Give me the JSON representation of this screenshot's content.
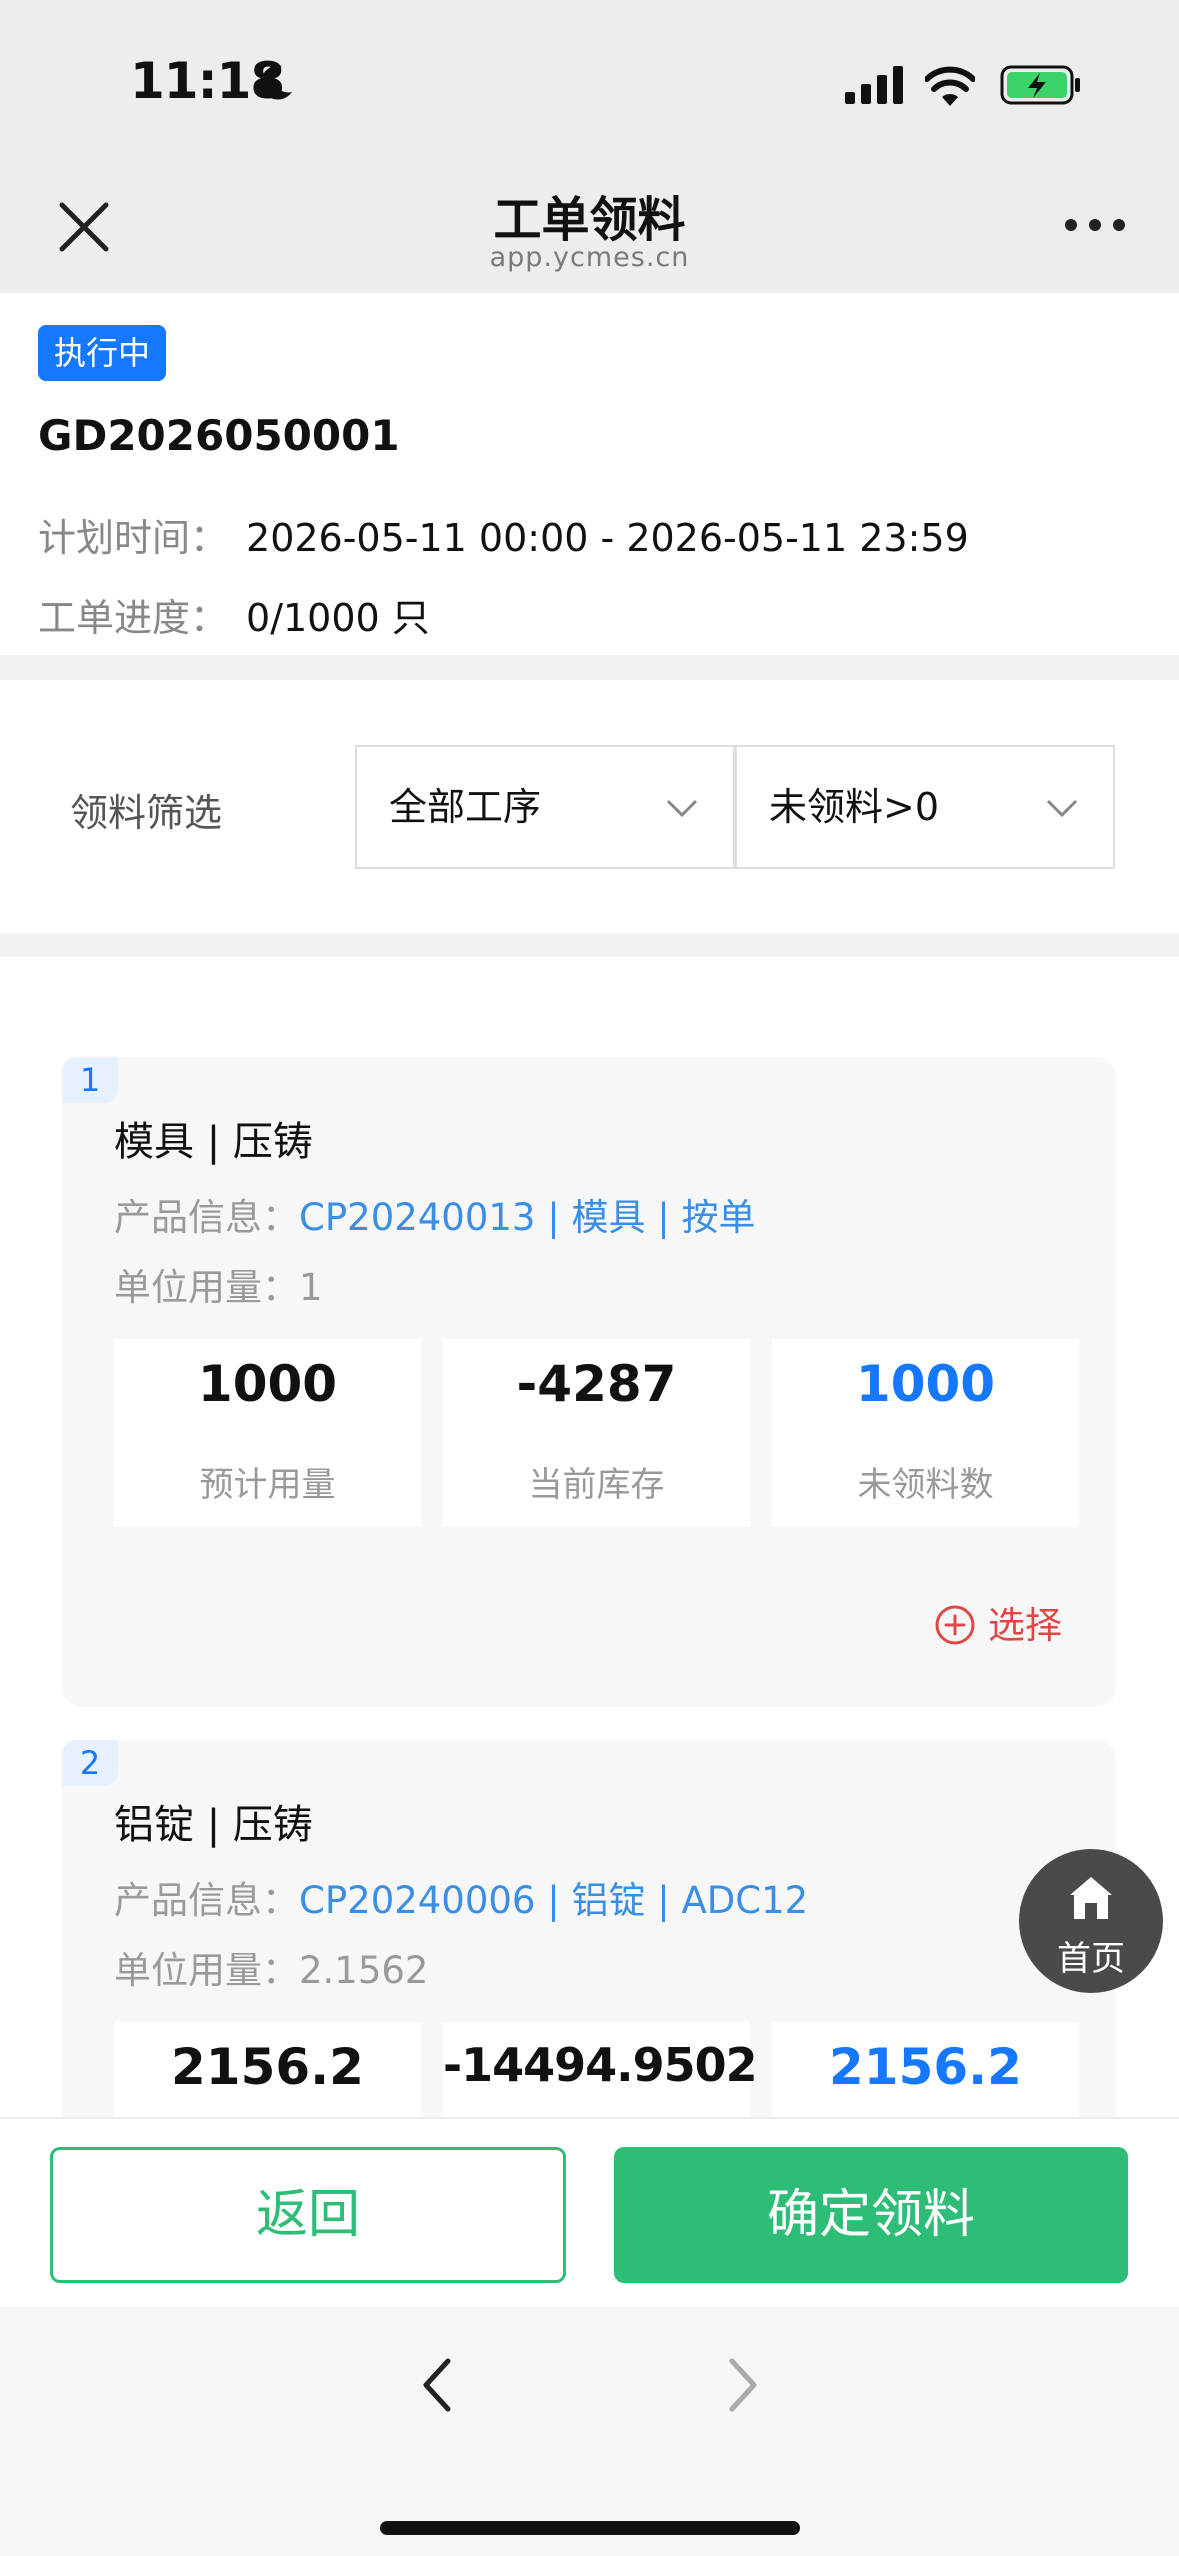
{
  "status_bar": {
    "time": "11:18"
  },
  "nav": {
    "title": "工单领料",
    "subtitle": "app.ycmes.cn"
  },
  "order": {
    "status": "执行中",
    "number": "GD2026050001",
    "plan_time_label": "计划时间：",
    "plan_time": "2026-05-11 00:00 - 2026-05-11 23:59",
    "progress_label": "工单进度：",
    "progress": "0/1000 只"
  },
  "filter": {
    "label": "领料筛选",
    "process_select": "全部工序",
    "status_select": "未领料>0"
  },
  "materials": [
    {
      "index": "1",
      "title": "模具 | 压铸",
      "product_label": "产品信息：",
      "product": "CP20240013 | 模具 | 按单",
      "unit_label": "单位用量：",
      "unit": "1",
      "stats": [
        {
          "value": "1000",
          "caption": "预计用量"
        },
        {
          "value": "-4287",
          "caption": "当前库存"
        },
        {
          "value": "1000",
          "caption": "未领料数"
        }
      ],
      "select_label": "选择"
    },
    {
      "index": "2",
      "title": "铝锭 | 压铸",
      "product_label": "产品信息：",
      "product": "CP20240006 | 铝锭 | ADC12",
      "unit_label": "单位用量：",
      "unit": "2.1562",
      "stats": [
        {
          "value": "2156.2",
          "caption": ""
        },
        {
          "value": "-14494.9502",
          "caption": ""
        },
        {
          "value": "2156.2",
          "caption": ""
        }
      ]
    }
  ],
  "fab": {
    "label": "首页"
  },
  "actions": {
    "back": "返回",
    "confirm": "确定领料"
  },
  "colors": {
    "accent_blue": "#1677ff",
    "primary_green": "#2dbd76",
    "select_red": "#e04848"
  }
}
